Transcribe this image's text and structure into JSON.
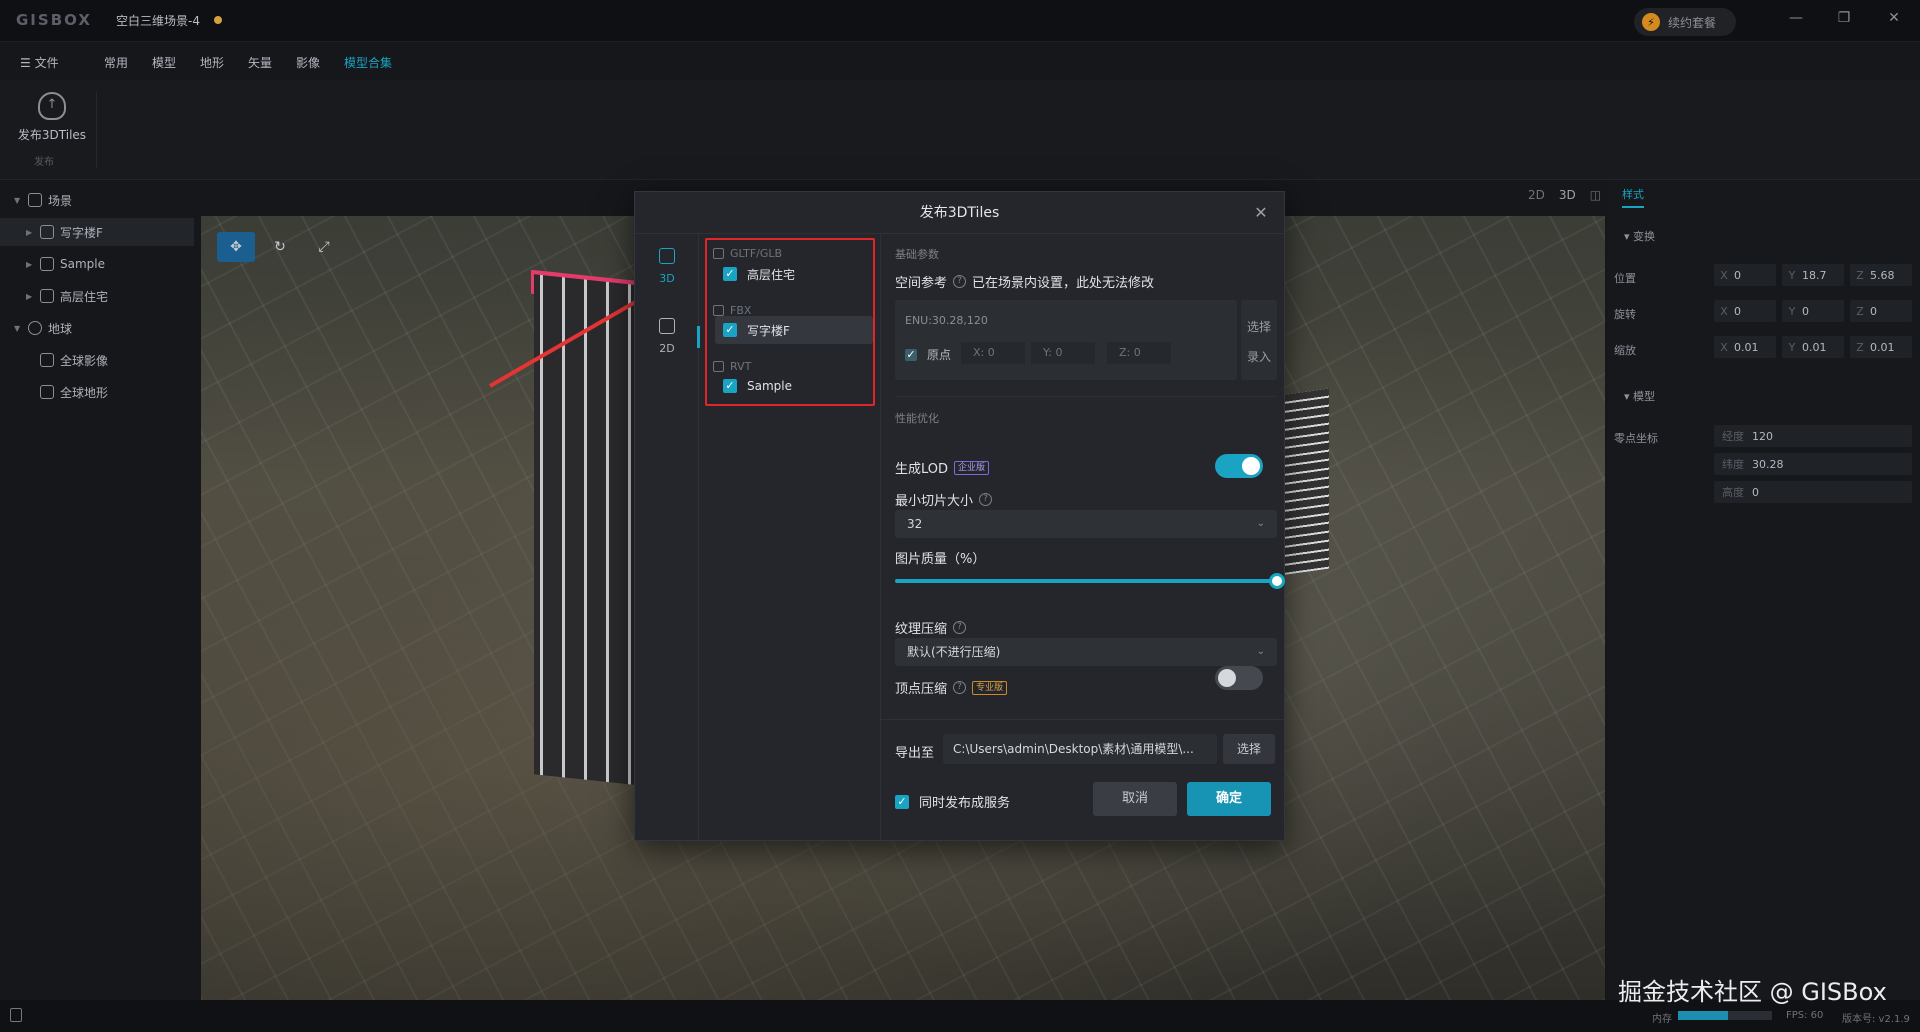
{
  "app": {
    "logo": "GISBOX",
    "scene_title": "空白三维场景-4",
    "renew_label": "续约套餐"
  },
  "menu": {
    "file": "文件",
    "items": [
      "常用",
      "模型",
      "地形",
      "矢量",
      "影像",
      "模型合集"
    ]
  },
  "ribbon": {
    "publish_label": "发布3DTiles",
    "group_label": "发布"
  },
  "tree": {
    "scene": "场景",
    "items": [
      "写字楼F",
      "Sample",
      "高层住宅"
    ],
    "earth": "地球",
    "earth_items": [
      "全球影像",
      "全球地形"
    ]
  },
  "view_modes": [
    "2D",
    "3D"
  ],
  "right_panel": {
    "tab": "样式",
    "transform_section": "变换",
    "position_label": "位置",
    "rotation_label": "旋转",
    "scale_label": "缩放",
    "position": {
      "x": "0",
      "y": "18.7",
      "z": "5.68"
    },
    "rotation": {
      "x": "0",
      "y": "0",
      "z": "0"
    },
    "scale": {
      "x": "0.01",
      "y": "0.01",
      "z": "0.01"
    },
    "model_section": "模型",
    "zero_label": "零点坐标",
    "lon_label": "经度",
    "lat_label": "纬度",
    "height_label": "高度",
    "lon": "120",
    "lat": "30.28",
    "height": "0"
  },
  "status": {
    "memory_label": "内存",
    "memory_fraction": 0.53,
    "fps": "FPS: 60",
    "version": "版本号: v2.1.9"
  },
  "watermark": "掘金技术社区 @ GISBox",
  "dialog": {
    "title": "发布3DTiles",
    "modes": [
      "3D",
      "2D"
    ],
    "groups": [
      {
        "name": "GLTF/GLB",
        "items": [
          "高层住宅"
        ]
      },
      {
        "name": "FBX",
        "items": [
          "写字楼F"
        ]
      },
      {
        "name": "RVT",
        "items": [
          "Sample"
        ]
      }
    ],
    "basic_section": "基础参数",
    "spatial_label": "空间参考",
    "spatial_note": "已在场景内设置，此处无法修改",
    "enu": "ENU:30.28,120",
    "origin_label": "原点",
    "origin_x": "X: 0",
    "origin_y": "Y: 0",
    "origin_z": "Z: 0",
    "pick_label": "选择",
    "enter_label": "录入",
    "perf_section": "性能优化",
    "lod_label": "生成LOD",
    "enterprise_badge": "企业版",
    "lod_enabled": true,
    "min_tile_label": "最小切片大小",
    "min_tile_value": "32",
    "image_quality_label": "图片质量（%）",
    "image_quality": 100,
    "texture_label": "纹理压缩",
    "texture_value": "默认(不进行压缩)",
    "vertex_label": "顶点压缩",
    "pro_badge": "专业版",
    "vertex_enabled": false,
    "export_label": "导出至",
    "export_path": "C:\\Users\\admin\\Desktop\\素材\\通用模型\\...",
    "export_select": "选择",
    "publish_service_label": "同时发布成服务",
    "cancel_label": "取消",
    "ok_label": "确定"
  }
}
